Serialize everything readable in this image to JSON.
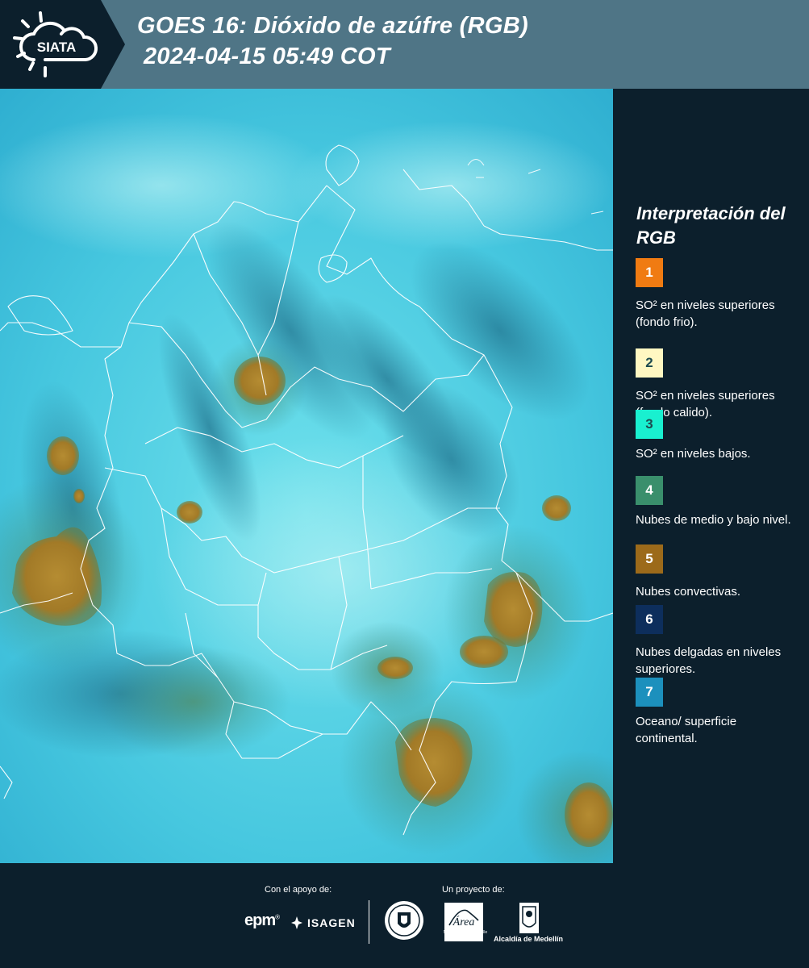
{
  "header": {
    "logo_text": "SIATA",
    "title_line1": "GOES 16: Dióxido de azúfre (RGB)",
    "title_line2": "2024-04-15 05:49 COT"
  },
  "legend": {
    "title": "Interpretación del RGB",
    "items": [
      {
        "number": "1",
        "color": "#f07b12",
        "label": "SO² en niveles superiores (fondo frio)."
      },
      {
        "number": "2",
        "color": "#fff7c2",
        "label": "SO² en niveles superiores (fondo calido)."
      },
      {
        "number": "3",
        "color": "#19f0d0",
        "label": "SO² en niveles bajos."
      },
      {
        "number": "4",
        "color": "#3a8f6c",
        "label": "Nubes de medio y bajo nivel."
      },
      {
        "number": "5",
        "color": "#9c6a1a",
        "label": "Nubes convectivas."
      },
      {
        "number": "6",
        "color": "#0d2e5c",
        "label": "Nubes delgadas en niveles superiores."
      },
      {
        "number": "7",
        "color": "#1c90bd",
        "label": "Oceano/ superficie continental."
      }
    ]
  },
  "footer": {
    "support_caption": "Con el apoyo de:",
    "project_caption": "Un proyecto de:",
    "sponsors": [
      "epm",
      "ISAGEN"
    ],
    "partners": [
      "METROPOLITANA Valle de Aburrá",
      "Alcaldía de Medellín"
    ]
  },
  "colors": {
    "background": "#0c1f2c",
    "header_bar": "#4f7586",
    "map_base": "#47c6dc",
    "convective": "#a8842a",
    "boundaries": "#ffffff"
  }
}
